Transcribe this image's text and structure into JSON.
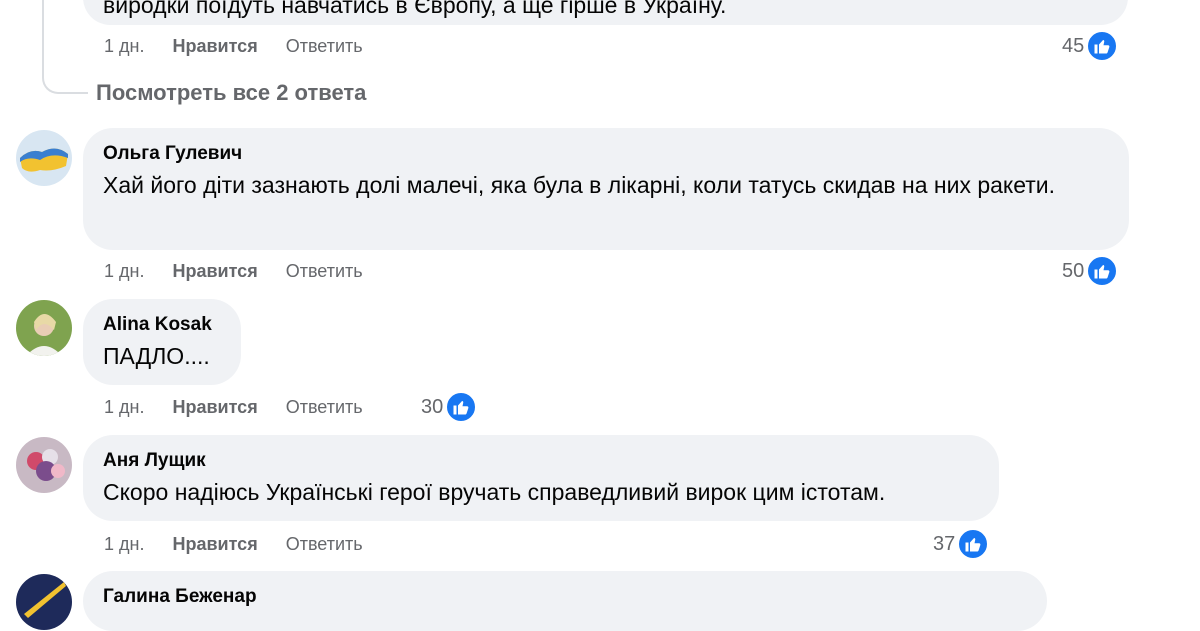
{
  "top_comment": {
    "text_partial": "виродки поїдуть навчатись в Європу, а ще гірше в Україну.",
    "time": "1 дн.",
    "like_label": "Нравится",
    "reply_label": "Ответить",
    "reactions": "45"
  },
  "view_replies": "Посмотреть все 2 ответа",
  "comments": [
    {
      "author": "Ольга Гулевич",
      "text": "Хай його діти зазнають долі малечі, яка була в лікарні, коли татусь скидав на них ракети.",
      "time": "1 дн.",
      "like_label": "Нравится",
      "reply_label": "Ответить",
      "reactions": "50"
    },
    {
      "author": "Alina Kosak",
      "text": "ПАДЛО....",
      "time": "1 дн.",
      "like_label": "Нравится",
      "reply_label": "Ответить",
      "reactions": "30"
    },
    {
      "author": "Аня Лущик",
      "text": "Скоро надіюсь Українські герої вручать справедливий вирок цим істотам.",
      "time": "1 дн.",
      "like_label": "Нравится",
      "reply_label": "Ответить",
      "reactions": "37"
    },
    {
      "author": "Галина Беженар"
    }
  ],
  "colors": {
    "bubble": "#f0f2f5",
    "like_blue": "#1877f2",
    "meta_gray": "#65676b"
  },
  "icons": {
    "reaction": "like-thumbs-up-icon"
  }
}
